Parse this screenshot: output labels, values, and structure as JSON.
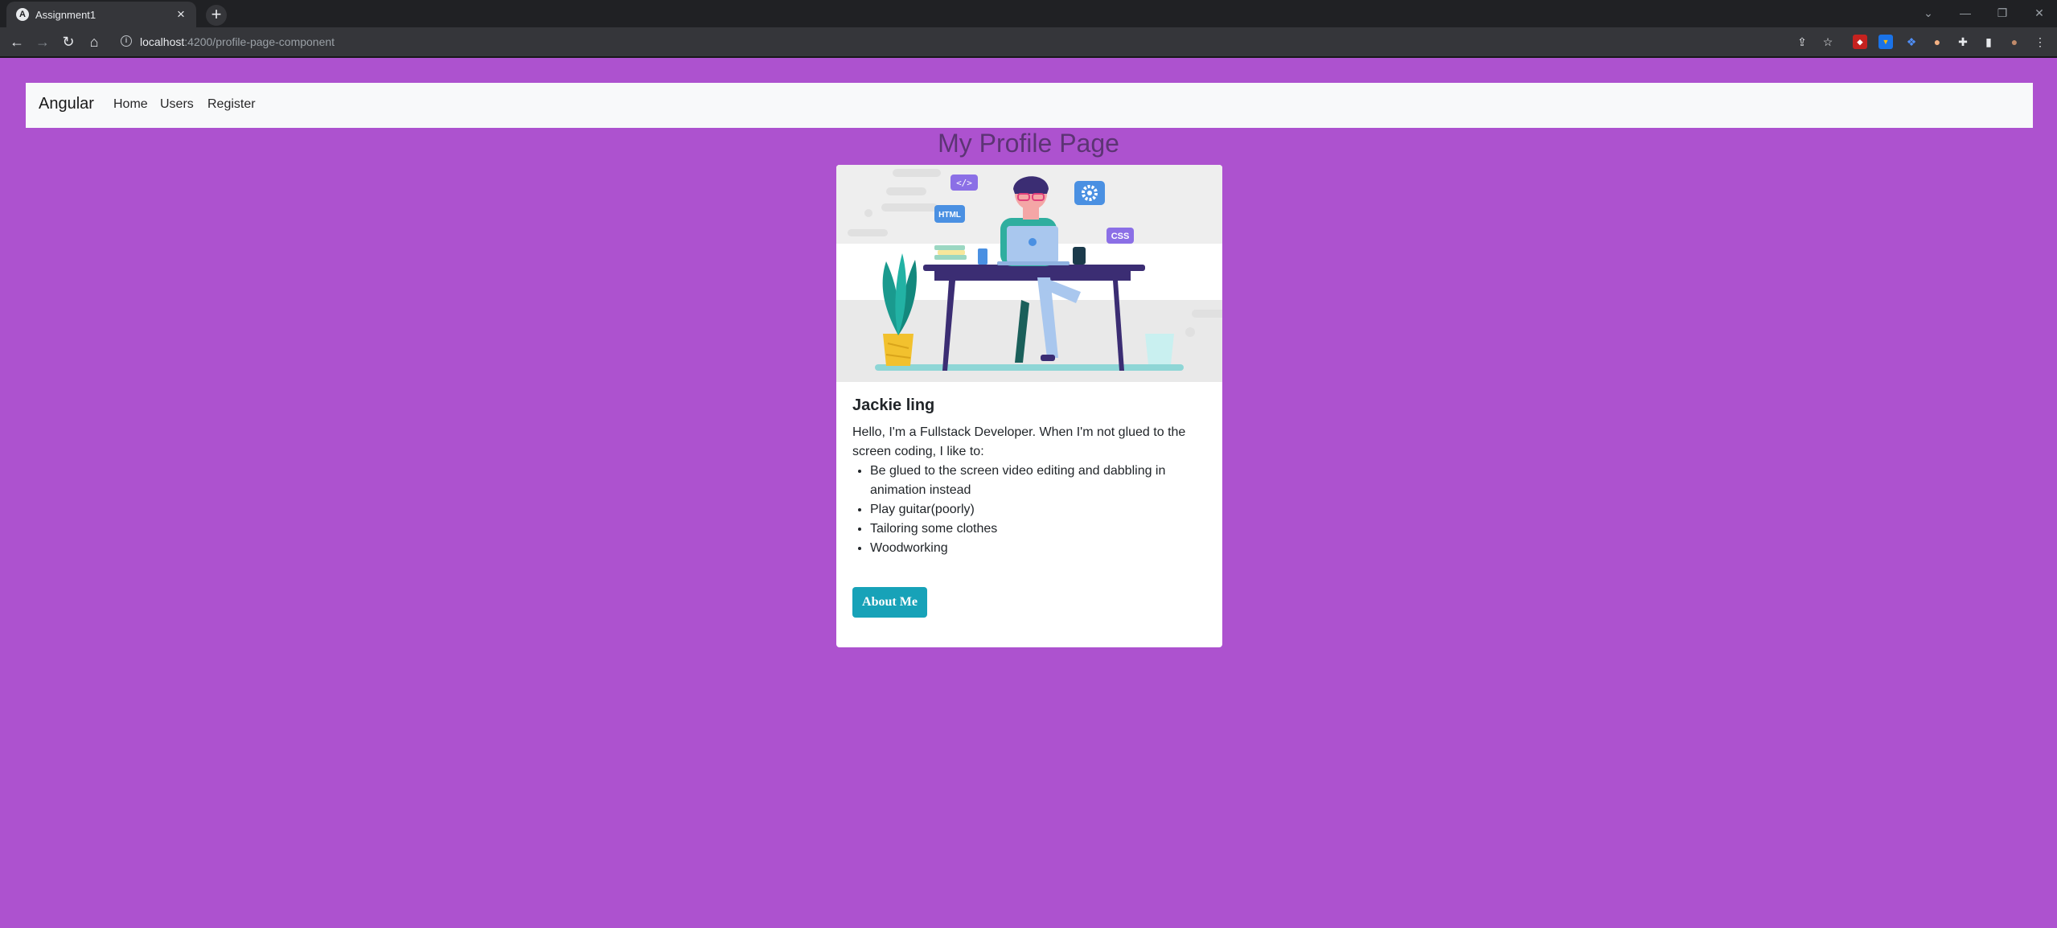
{
  "browser": {
    "tab_title": "Assignment1",
    "tab_favicon": "A",
    "new_tab_label": "+",
    "url_host": "localhost",
    "url_path": ":4200/profile-page-component",
    "window_controls": [
      "⌄",
      "—",
      "❐",
      "✕"
    ]
  },
  "navbar": {
    "brand": "Angular",
    "links": [
      "Home",
      "Users",
      "Register"
    ]
  },
  "page": {
    "title": "My Profile Page"
  },
  "card": {
    "title": "Jackie ling",
    "intro": "Hello, I'm a Fullstack Developer. When I'm not glued to the screen coding, I like to:",
    "interests": [
      "Be glued to the screen video editing and dabbling in animation instead",
      "Play guitar(poorly)",
      "Tailoring some clothes",
      "Woodworking"
    ],
    "button_label": "About Me",
    "illustration_badges": [
      "</>",
      "HTML",
      "CSS"
    ]
  },
  "colors": {
    "page_background": "#ad52cf",
    "navbar_background": "#f8f9fa",
    "page_title": "#5c3474",
    "button": "#17a2b8",
    "card": "#ffffff"
  }
}
